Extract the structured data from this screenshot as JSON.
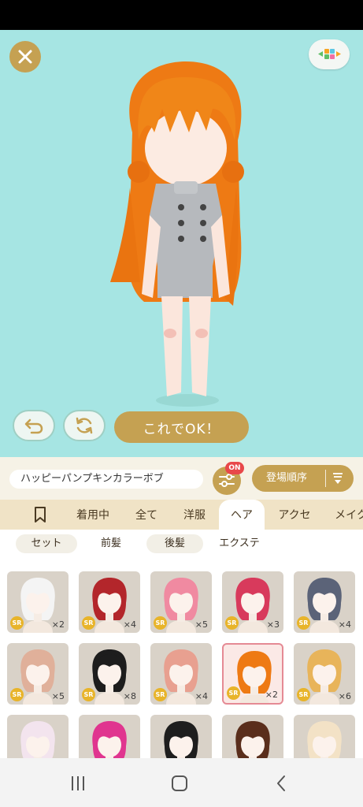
{
  "editor": {
    "ok_label": "これでOK！",
    "name_label": "ハッピーパンプキンカラーボブ",
    "filter_on_badge": "ON",
    "sort_label": "登場順序"
  },
  "tabs": [
    {
      "label": "",
      "icon": "bookmark-icon"
    },
    {
      "label": "着用中"
    },
    {
      "label": "全て"
    },
    {
      "label": "洋服"
    },
    {
      "label": "ヘア",
      "active": true
    },
    {
      "label": "アクセ"
    },
    {
      "label": "メイク"
    }
  ],
  "subtabs": [
    {
      "label": "セット",
      "pill": true
    },
    {
      "label": "前髪"
    },
    {
      "label": "後髪",
      "pill": true
    },
    {
      "label": "エクステ"
    }
  ],
  "items": [
    {
      "rarity": "SR",
      "qty": "×2",
      "hair": "#f4f4f4"
    },
    {
      "rarity": "SR",
      "qty": "×4",
      "hair": "#b3262b"
    },
    {
      "rarity": "SR",
      "qty": "×5",
      "hair": "#f08aa1"
    },
    {
      "rarity": "SR",
      "qty": "×3",
      "hair": "#d83a5c"
    },
    {
      "rarity": "SR",
      "qty": "×4",
      "hair": "#5b6378"
    },
    {
      "rarity": "SR",
      "qty": "×5",
      "hair": "#e0b09a"
    },
    {
      "rarity": "SR",
      "qty": "×8",
      "hair": "#1d1d1d"
    },
    {
      "rarity": "SR",
      "qty": "×4",
      "hair": "#e8a090"
    },
    {
      "rarity": "SR",
      "qty": "×2",
      "hair": "#ee7a14",
      "selected": true
    },
    {
      "rarity": "SR",
      "qty": "×6",
      "hair": "#e8b45a"
    },
    {
      "rarity": "",
      "qty": "",
      "hair": "#f3e4ee"
    },
    {
      "rarity": "",
      "qty": "",
      "hair": "#e0358f"
    },
    {
      "rarity": "",
      "qty": "",
      "hair": "#1e1e1e"
    },
    {
      "rarity": "",
      "qty": "",
      "hair": "#5a2e1c"
    },
    {
      "rarity": "",
      "qty": "",
      "hair": "#f3e2c6"
    }
  ],
  "colors": {
    "accent": "#c5a152",
    "stage_bg": "#a6e5e3",
    "badge_red": "#e8484a"
  }
}
